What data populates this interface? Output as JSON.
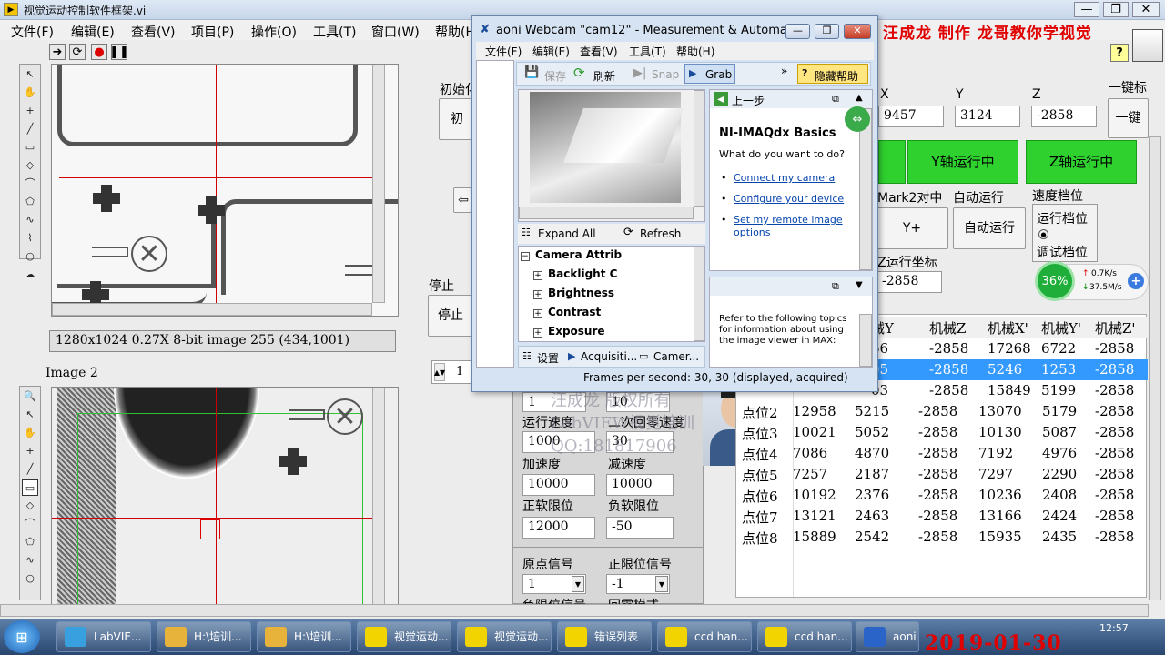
{
  "app": {
    "title": "视觉运动控制软件框架.vi",
    "menu": [
      "文件(F)",
      "编辑(E)",
      "查看(V)",
      "项目(P)",
      "操作(O)",
      "工具(T)",
      "窗口(W)",
      "帮助(H)"
    ],
    "banner": "汪成龙 制作 龙哥教你学视觉"
  },
  "image1": {
    "info": "1280x1024 0.27X 8-bit image 255     (434,1001)"
  },
  "image2": {
    "label": "Image 2"
  },
  "left_panel": {
    "init_label": "初始化",
    "init_button": "初",
    "stop_label": "停止",
    "stop_button": "停止",
    "num_value": "1"
  },
  "coords": {
    "x_label": "X",
    "y_label": "Y",
    "z_label": "Z",
    "x_value": "9457",
    "y_value": "3124",
    "z_value": "-2858",
    "one_key_label": "一键标",
    "one_key_button": "一键"
  },
  "axis_buttons": {
    "y_run": "Y轴运行中",
    "z_run": "Z轴运行中"
  },
  "motion": {
    "mark2_label": "Mark2对中",
    "auto_label": "自动运行",
    "speed_label": "速度档位",
    "y_plus": "Y+",
    "auto_button": "自动运行",
    "run_gear": "运行档位",
    "debug_gear": "调试档位",
    "z_coord_label": "Z运行坐标",
    "z_coord_value": "-2858"
  },
  "monitor": {
    "percent": "36%",
    "up": "0.7K/s",
    "down": "37.5M/s"
  },
  "params": {
    "row0": "1",
    "row0b": "10",
    "speed_label": "运行速度",
    "speed2_label": "二次回零速度",
    "speed_value": "1000",
    "speed2_value": "30",
    "acc_label": "加速度",
    "dec_label": "减速度",
    "acc_value": "10000",
    "dec_value": "10000",
    "pos_limit_label": "正软限位",
    "neg_limit_label": "负软限位",
    "pos_limit_value": "12000",
    "neg_limit_value": "-50",
    "origin_label": "原点信号",
    "plimit_label": "正限位信号",
    "origin_value": "1",
    "plimit_value": "-1",
    "neg_signal_label": "负限位信号",
    "return_mode_label": "回零模式"
  },
  "watermark": {
    "line1": "汪成龙 版权所有",
    "line2": "LabVIEW视觉培训",
    "line3": "QQ:181817906"
  },
  "table": {
    "headers": [
      "械Y",
      "机械Z",
      "机械X'",
      "机械Y'",
      "机械Z'"
    ],
    "rows": [
      {
        "name": "",
        "c": [
          "66",
          "-2858",
          "17268",
          "6722",
          "-2858"
        ]
      },
      {
        "name": "",
        "c": [
          "05",
          "-2858",
          "5246",
          "1253",
          "-2858"
        ],
        "sel": true
      },
      {
        "name": "",
        "c": [
          "03",
          "-2858",
          "15849",
          "5199",
          "-2858"
        ]
      },
      {
        "name": "点位2",
        "c": [
          "12958",
          "5215",
          "-2858",
          "13070",
          "5179",
          "-2858"
        ]
      },
      {
        "name": "点位3",
        "c": [
          "10021",
          "5052",
          "-2858",
          "10130",
          "5087",
          "-2858"
        ]
      },
      {
        "name": "点位4",
        "c": [
          "7086",
          "4870",
          "-2858",
          "7192",
          "4976",
          "-2858"
        ]
      },
      {
        "name": "点位5",
        "c": [
          "7257",
          "2187",
          "-2858",
          "7297",
          "2290",
          "-2858"
        ]
      },
      {
        "name": "点位6",
        "c": [
          "10192",
          "2376",
          "-2858",
          "10236",
          "2408",
          "-2858"
        ]
      },
      {
        "name": "点位7",
        "c": [
          "13121",
          "2463",
          "-2858",
          "13166",
          "2424",
          "-2858"
        ]
      },
      {
        "name": "点位8",
        "c": [
          "15889",
          "2542",
          "-2858",
          "15935",
          "2435",
          "-2858"
        ]
      }
    ]
  },
  "webcam": {
    "title": "aoni Webcam  \"cam12\" - Measurement & Automati...",
    "menu": [
      "文件(F)",
      "编辑(E)",
      "查看(V)",
      "工具(T)",
      "帮助(H)"
    ],
    "toolbar": {
      "save": "保存",
      "refresh": "刷新",
      "snap": "Snap",
      "grab": "Grab",
      "hide_help": "隐藏帮助"
    },
    "help": {
      "back": "上一步",
      "heading": "NI-IMAQdx Basics",
      "question": "What do you want to do?",
      "link1": "Connect my camera",
      "link2": "Configure your device",
      "link3": "Set my remote image options",
      "refer": "Refer to the following topics for information about using the image viewer in MAX:"
    },
    "attr": {
      "expand": "Expand All",
      "refresh": "Refresh",
      "root": "Camera Attrib",
      "items": [
        "Backlight C",
        "Brightness",
        "Contrast",
        "Exposure"
      ]
    },
    "tabs": {
      "settings": "设置",
      "acq": "Acquisiti...",
      "cam": "Camer..."
    },
    "fps": "Frames per second: 30, 30 (displayed, acquired)"
  },
  "taskbar": {
    "items": [
      "LabVIE...",
      "H:\\培训...",
      "H:\\培训...",
      "视觉运动...",
      "视觉运动...",
      "错误列表",
      "ccd han...",
      "ccd han...",
      "aoni W"
    ],
    "time_small": "12:57",
    "datetime": "2019-01-30  12:57:44"
  }
}
